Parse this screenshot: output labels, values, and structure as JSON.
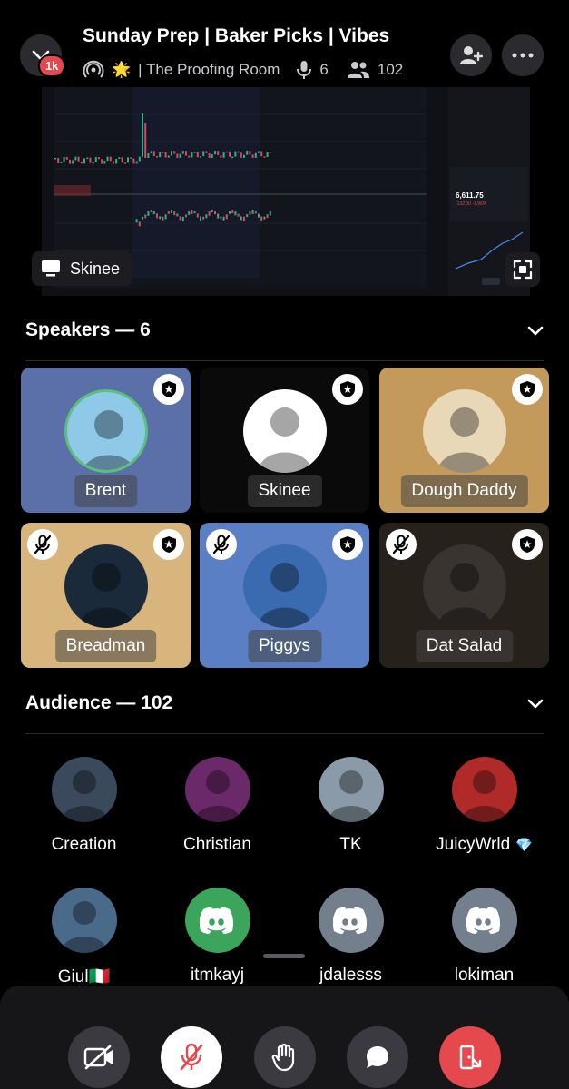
{
  "header": {
    "title": "Sunday Prep | Baker Picks | Vibes",
    "notification_badge": "1k",
    "channel_name": "| The Proofing Room",
    "channel_emoji": "🌟",
    "speaker_count": "6",
    "listener_count": "102"
  },
  "stream": {
    "streamer_label": "Skinee",
    "price_label": "6,611.75",
    "price_change": "-132.00 -1.96%"
  },
  "speakers_section": {
    "label": "Speakers — 6"
  },
  "speakers": [
    {
      "name": "Brent",
      "muted": false,
      "moderator": true,
      "bg": "#5b6fa8"
    },
    {
      "name": "Skinee",
      "muted": false,
      "moderator": true,
      "bg": "#0a0a0a"
    },
    {
      "name": "Dough Daddy",
      "muted": false,
      "moderator": true,
      "bg": "#c49a5a"
    },
    {
      "name": "Breadman",
      "muted": true,
      "moderator": true,
      "bg": "#d8b57c"
    },
    {
      "name": "Piggys",
      "muted": true,
      "moderator": true,
      "bg": "#5a7fc4"
    },
    {
      "name": "Dat Salad",
      "muted": true,
      "moderator": true,
      "bg": "#27211c"
    }
  ],
  "audience_section": {
    "label": "Audience — 102"
  },
  "audience": [
    {
      "name": "Creation",
      "color": "#3a4a5c"
    },
    {
      "name": "Christian",
      "color": "#6a2a6a"
    },
    {
      "name": "TK",
      "color": "#8a9aa8"
    },
    {
      "name": "JuicyWrld",
      "color": "#b02a2a",
      "badge": "💎"
    },
    {
      "name": "Giul🇮🇹",
      "color": "#4a6a8a"
    },
    {
      "name": "itmkayj",
      "color": "#3ba55c"
    },
    {
      "name": "jdalesss",
      "color": "#747f8d"
    },
    {
      "name": "lokiman",
      "color": "#747f8d"
    }
  ],
  "colors": {
    "danger": "#e5484d",
    "discord_green": "#3ba55c",
    "discord_grey": "#747f8d",
    "control_grey": "#3a3a40"
  },
  "icons": [
    "chevron-down-icon",
    "add-friend-icon",
    "more-icon",
    "stage-icon",
    "mic-icon",
    "people-icon",
    "screen-icon",
    "fullscreen-icon",
    "shield-icon",
    "mic-off-icon",
    "video-off-icon",
    "raise-hand-icon",
    "chat-icon",
    "leave-icon"
  ]
}
